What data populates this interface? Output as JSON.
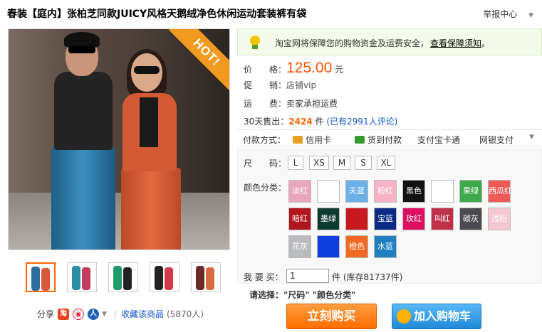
{
  "title": "春装【庭内】张柏芝同款JUICY风格天鹅绒净色休闲运动套装裤有袋",
  "report_label": "举报中心",
  "hot_badge": "HOT!",
  "guarantee": {
    "text": "淘宝网将保障您的购物资金及运费安全，",
    "link": "查看保障须知",
    "tail": "。"
  },
  "price": {
    "label": "价　　格：",
    "value": "125.00",
    "unit": "元"
  },
  "promo": {
    "label": "促　　销：",
    "value": "店铺vip"
  },
  "shipping": {
    "label": "运　　费：",
    "value": "卖家承担运费"
  },
  "sales": {
    "label": "30天售出：",
    "count": "2424",
    "unit": "件",
    "reviews": "(已有2991人评论)"
  },
  "payment": {
    "label": "付款方式：",
    "methods": [
      "信用卡",
      "货到付款",
      "支付宝卡通",
      "网银支付"
    ]
  },
  "size": {
    "label": "尺　　码：",
    "options": [
      "L",
      "XS",
      "M",
      "S",
      "XL"
    ]
  },
  "color": {
    "label": "颜色分类：",
    "options": [
      {
        "name": "淡红",
        "hex": "#e9a7bf"
      },
      {
        "name": "",
        "hex": "#ffffff"
      },
      {
        "name": "天蓝",
        "hex": "#6cb0e8"
      },
      {
        "name": "粉红",
        "hex": "#f6b3c6"
      },
      {
        "name": "黑色",
        "hex": "#111111"
      },
      {
        "name": "",
        "hex": "#ffffff"
      },
      {
        "name": "果绿",
        "hex": "#3fa84a"
      },
      {
        "name": "西瓜红",
        "hex": "#ef5a57"
      },
      {
        "name": "暗红",
        "hex": "#b0141c"
      },
      {
        "name": "墨绿",
        "hex": "#0d3b30"
      },
      {
        "name": "",
        "hex": "#c8191f"
      },
      {
        "name": "宝蓝",
        "hex": "#0b2a86"
      },
      {
        "name": "玫红",
        "hex": "#dd1060"
      },
      {
        "name": "叫红",
        "hex": "#c03048"
      },
      {
        "name": "碳灰",
        "hex": "#4a4a50"
      },
      {
        "name": "浅粉",
        "hex": "#f4c6d0"
      },
      {
        "name": "花灰",
        "hex": "#b9bbbe"
      },
      {
        "name": "",
        "hex": "#0f3fe0"
      },
      {
        "name": "橙色",
        "hex": "#f06a24"
      },
      {
        "name": "水蓝",
        "hex": "#1f7fc0"
      }
    ]
  },
  "quantity": {
    "label": "我 要 买：",
    "value": "1",
    "stock": "件 (库存81737件)"
  },
  "select_hint": {
    "label": "请选择：",
    "items": "\"尺码\"  \"颜色分类\""
  },
  "buttons": {
    "buy": "立刻购买",
    "cart": "加入购物车"
  },
  "share": {
    "label": "分享",
    "favorite": "收藏该商品",
    "fav_count": "(5870人)"
  },
  "thumbnails": 5
}
